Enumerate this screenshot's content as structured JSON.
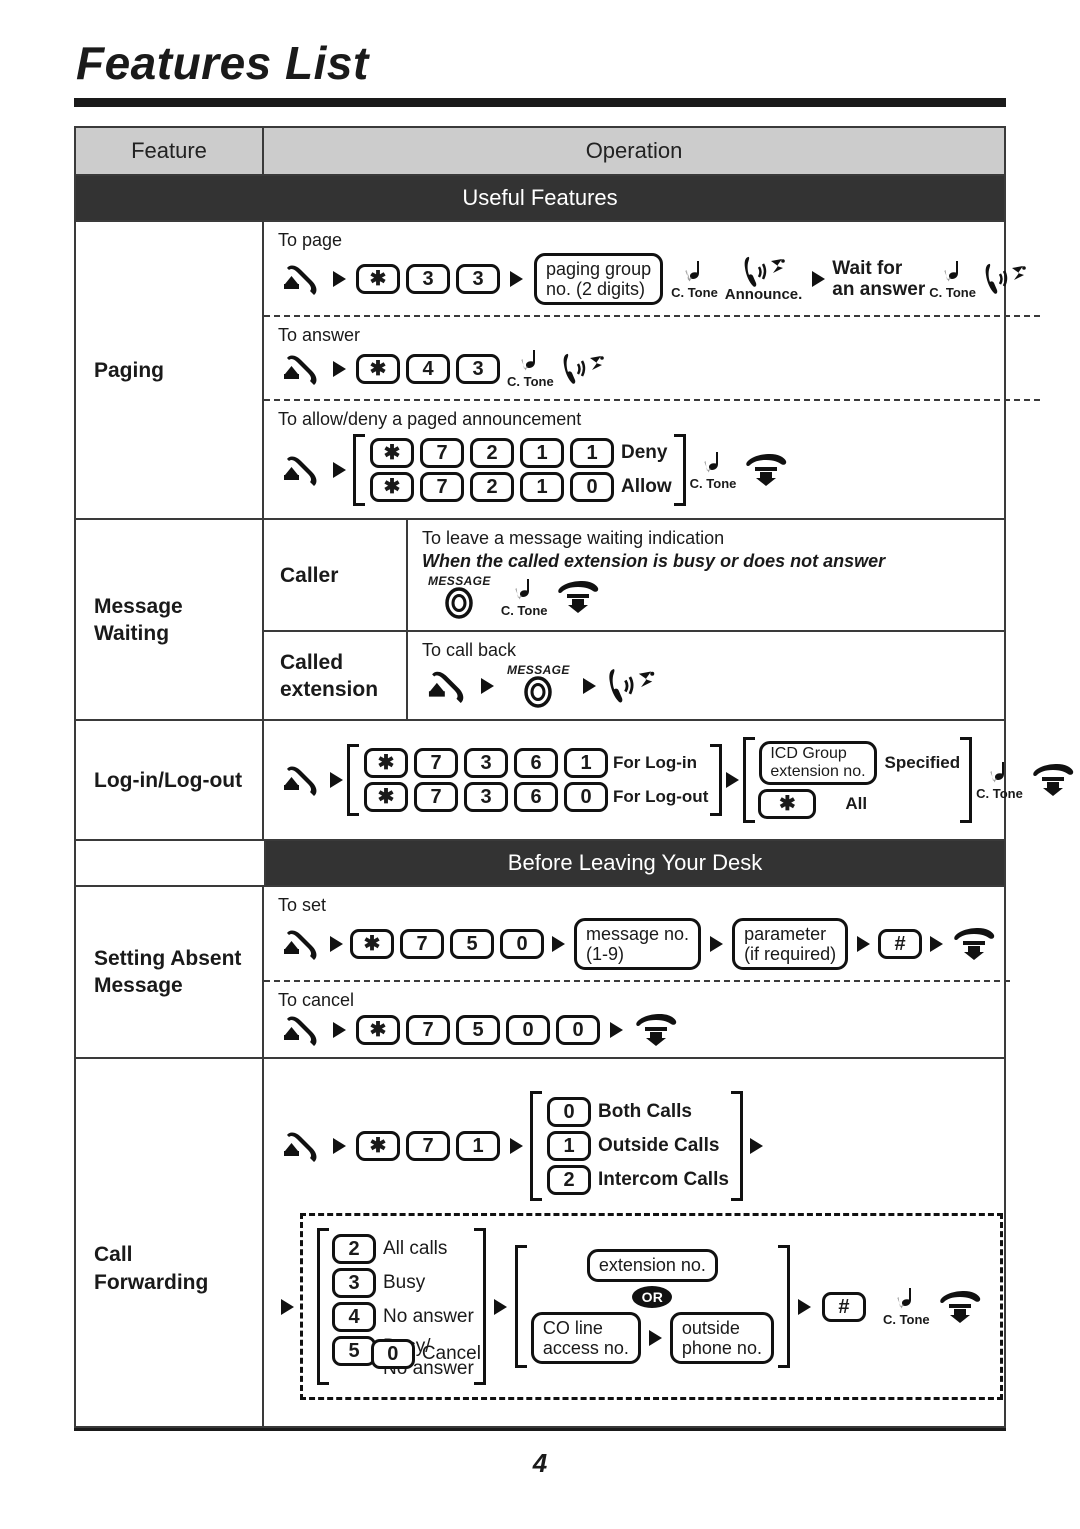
{
  "page": {
    "title": "Features List",
    "number": "4"
  },
  "table": {
    "headers": {
      "feature": "Feature",
      "operation": "Operation"
    },
    "bands": {
      "useful_features": "Useful Features",
      "before_leaving": "Before Leaving Your Desk"
    },
    "rows": {
      "paging": {
        "feature": "Paging",
        "to_page": {
          "caption": "To page",
          "keys": [
            "✱",
            "3",
            "3"
          ],
          "box": [
            "paging group",
            "no. (2 digits)"
          ],
          "tone": "C. Tone",
          "announce": "Announce.",
          "wait": [
            "Wait for",
            "an answer"
          ],
          "tone2": "C. Tone"
        },
        "to_answer": {
          "caption": "To answer",
          "keys": [
            "✱",
            "4",
            "3"
          ],
          "tone": "C. Tone"
        },
        "allow_deny": {
          "caption": "To allow/deny a paged announcement",
          "deny_keys": [
            "✱",
            "7",
            "2",
            "1",
            "1"
          ],
          "deny_label": "Deny",
          "allow_keys": [
            "✱",
            "7",
            "2",
            "1",
            "0"
          ],
          "allow_label": "Allow",
          "tone": "C. Tone"
        }
      },
      "message_waiting": {
        "feature": [
          "Message",
          "Waiting"
        ],
        "caller": {
          "label": "Caller",
          "caption": "To leave a message waiting indication",
          "condition": "When the called extension is busy or does not answer",
          "button": "MESSAGE",
          "tone": "C. Tone"
        },
        "called_extension": {
          "label": [
            "Called",
            "extension"
          ],
          "caption": "To call back",
          "button": "MESSAGE"
        }
      },
      "log_in_out": {
        "feature": "Log-in/Log-out",
        "login_keys": [
          "✱",
          "7",
          "3",
          "6",
          "1"
        ],
        "login_label": "For Log-in",
        "logout_keys": [
          "✱",
          "7",
          "3",
          "6",
          "0"
        ],
        "logout_label": "For Log-out",
        "icd_box": [
          "ICD Group",
          "extension no."
        ],
        "specified_label": "Specified",
        "all_key": "✱",
        "all_label": "All",
        "tone": "C. Tone"
      },
      "absent_message": {
        "feature": [
          "Setting Absent",
          "Message"
        ],
        "to_set": {
          "caption": "To set",
          "keys": [
            "✱",
            "7",
            "5",
            "0"
          ],
          "msg_box": [
            "message no.",
            "(1-9)"
          ],
          "param_box": [
            "parameter",
            "(if required)"
          ],
          "hash": "#"
        },
        "to_cancel": {
          "caption": "To cancel",
          "keys": [
            "✱",
            "7",
            "5",
            "0",
            "0"
          ]
        }
      },
      "call_forwarding": {
        "feature": [
          "Call",
          "Forwarding"
        ],
        "keys": [
          "✱",
          "7",
          "1"
        ],
        "call_types": [
          {
            "key": "0",
            "label": "Both Calls"
          },
          {
            "key": "1",
            "label": "Outside Calls"
          },
          {
            "key": "2",
            "label": "Intercom Calls"
          }
        ],
        "modes": [
          {
            "key": "2",
            "label": "All calls"
          },
          {
            "key": "3",
            "label": "Busy"
          },
          {
            "key": "4",
            "label": "No answer"
          },
          {
            "key": "5",
            "label": "Busy/\nNo answer"
          }
        ],
        "cancel": {
          "key": "0",
          "label": "Cancel"
        },
        "extension_box": "extension no.",
        "or": "OR",
        "co_box": [
          "CO line",
          "access no."
        ],
        "outside_box": [
          "outside",
          "phone no."
        ],
        "hash": "#",
        "tone": "C. Tone"
      }
    }
  },
  "icons": {
    "offhook": "offhook-handset-icon",
    "onhook": "onhook-handset-icon",
    "talk": "handset-talk-icon",
    "tone": "tone-note-icon",
    "message_button": "message-button-icon"
  }
}
